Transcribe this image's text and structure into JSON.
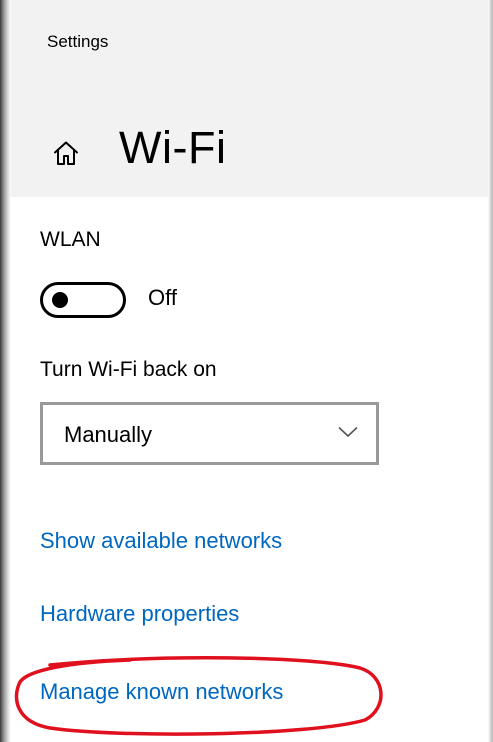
{
  "window": {
    "app_title": "Settings"
  },
  "header": {
    "page_title": "Wi-Fi",
    "home_icon": "home-icon"
  },
  "wlan": {
    "label": "WLAN",
    "toggle_on": false,
    "toggle_state_text": "Off"
  },
  "turn_back_on": {
    "label": "Turn Wi-Fi back on",
    "selected": "Manually",
    "chevron_icon": "chevron-down-icon"
  },
  "links": {
    "show_available": "Show available networks",
    "hardware_properties": "Hardware properties",
    "manage_known": "Manage known networks"
  },
  "colors": {
    "link": "#0067c0",
    "header_bg": "#f2f2f2",
    "annotation": "#e0101e"
  }
}
